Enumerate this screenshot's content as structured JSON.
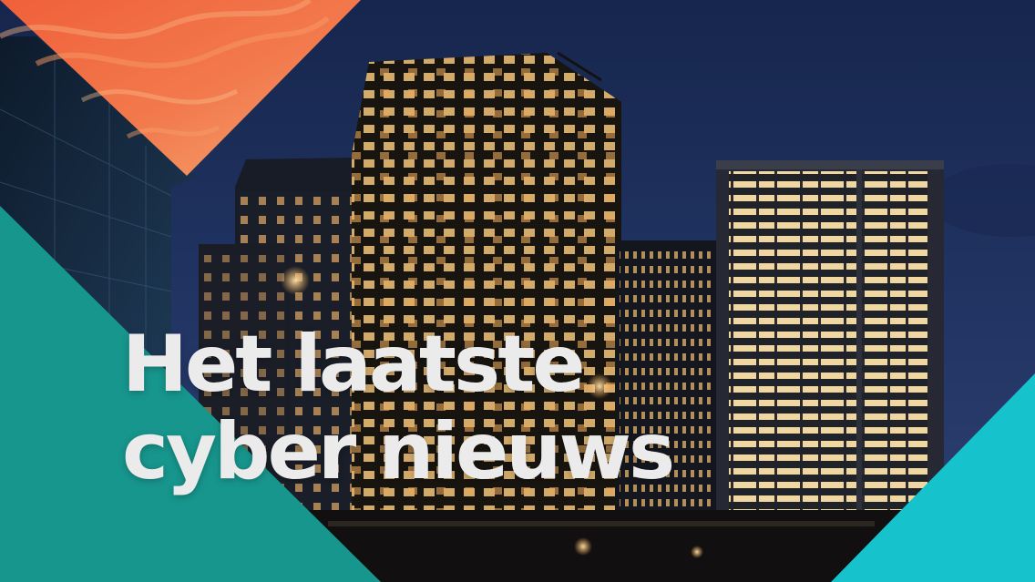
{
  "headline": {
    "line1": "Het laatste",
    "line2": "cyber nieuws"
  },
  "colors": {
    "sky_top": "#17284f",
    "sky_bottom": "#2a3c6a",
    "building_dark": "#141822",
    "window_light": "#f1c47a",
    "accent_orange": "#f0603a",
    "accent_peach": "#f6a06e",
    "accent_teal": "#17968d",
    "accent_cyan": "#16c3cd",
    "headline_text": "#ebebeb"
  }
}
